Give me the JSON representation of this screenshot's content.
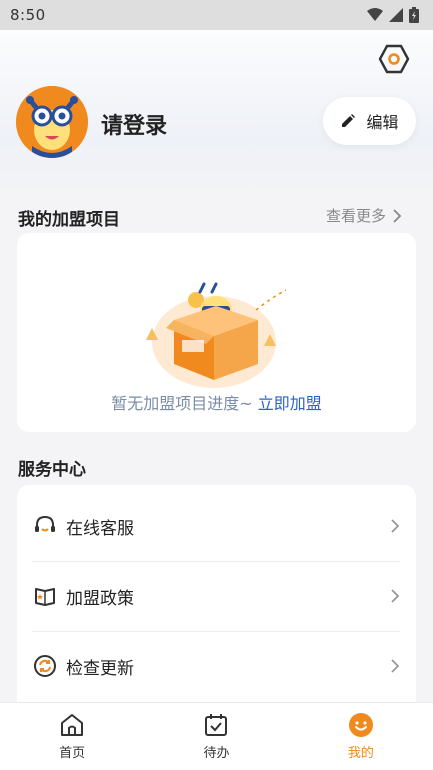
{
  "status_bar": {
    "time": "8:50"
  },
  "profile": {
    "login_text": "请登录",
    "edit_label": "编辑"
  },
  "franchise": {
    "title": "我的加盟项目",
    "more_label": "查看更多",
    "empty_text": "暂无加盟项目进度~",
    "join_link": "立即加盟"
  },
  "services": {
    "title": "服务中心",
    "items": [
      {
        "label": "在线客服",
        "icon": "headset-icon"
      },
      {
        "label": "加盟政策",
        "icon": "book-icon"
      },
      {
        "label": "检查更新",
        "icon": "refresh-icon"
      }
    ]
  },
  "tabs": [
    {
      "label": "首页",
      "icon": "home-icon",
      "active": false
    },
    {
      "label": "待办",
      "icon": "calendar-check-icon",
      "active": false
    },
    {
      "label": "我的",
      "icon": "smile-icon",
      "active": true
    }
  ],
  "colors": {
    "accent": "#f08a1f",
    "link": "#2b63c8",
    "muted": "#7a8ca6"
  }
}
